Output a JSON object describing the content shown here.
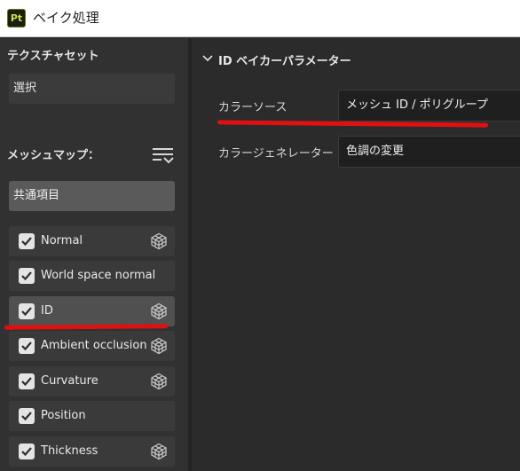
{
  "window": {
    "app_icon_text": "Pt",
    "title": "ベイク処理"
  },
  "sidebar": {
    "texture_set_label": "テクスチャセット",
    "texture_set_value": "選択",
    "mesh_maps_label": "メッシュマップ：",
    "common_item": "共通項目",
    "maps": [
      {
        "label": "Normal",
        "checked": true,
        "has_cube": true,
        "selected": false
      },
      {
        "label": "World space normal",
        "checked": true,
        "has_cube": false,
        "selected": false
      },
      {
        "label": "ID",
        "checked": true,
        "has_cube": true,
        "selected": true
      },
      {
        "label": "Ambient occlusion",
        "checked": true,
        "has_cube": true,
        "selected": false
      },
      {
        "label": "Curvature",
        "checked": true,
        "has_cube": true,
        "selected": false
      },
      {
        "label": "Position",
        "checked": true,
        "has_cube": false,
        "selected": false
      },
      {
        "label": "Thickness",
        "checked": true,
        "has_cube": true,
        "selected": false
      }
    ]
  },
  "main": {
    "section_title": "ID ベイカーパラメーター",
    "params": [
      {
        "label": "カラーソース",
        "value": "メッシュ ID / ポリグループ"
      },
      {
        "label": "カラージェネレーター",
        "value": "色調の変更"
      }
    ]
  },
  "colors": {
    "highlight_marker": "#e01010",
    "app_icon_accent": "#c2e349"
  }
}
